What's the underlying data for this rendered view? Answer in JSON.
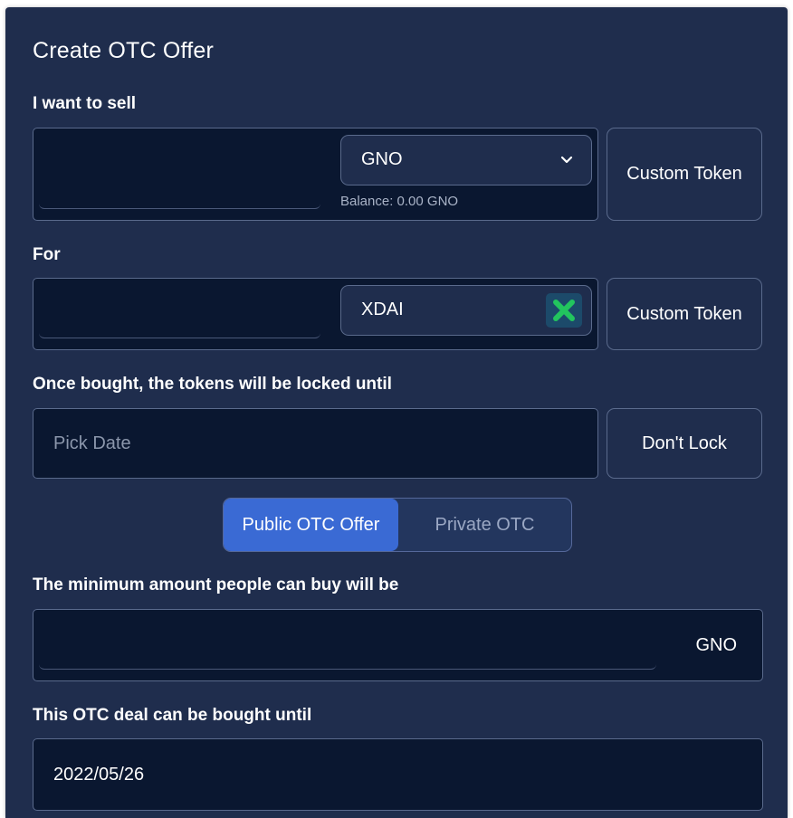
{
  "title": "Create OTC Offer",
  "sell": {
    "label": "I want to sell",
    "amount": "",
    "token": "GNO",
    "balance": "Balance: 0.00 GNO",
    "custom_token_label": "Custom Token"
  },
  "for": {
    "label": "For",
    "amount": "",
    "token": "XDAI",
    "custom_token_label": "Custom Token"
  },
  "lock": {
    "label": "Once bought, the tokens will be locked until",
    "placeholder": "Pick Date",
    "dont_lock_label": "Don't Lock"
  },
  "offer_type": {
    "options": [
      "Public OTC Offer",
      "Private OTC"
    ],
    "selected": "Public OTC Offer"
  },
  "minimum": {
    "label": "The minimum amount people can buy will be",
    "amount": "",
    "unit": "GNO"
  },
  "expiry": {
    "label": "This OTC deal can be bought until",
    "value": "2022/05/26"
  },
  "colors": {
    "panel": "#1f2d4d",
    "field": "#0a1730",
    "accent": "#3a6ad4",
    "x_icon_green": "#22c55e"
  }
}
